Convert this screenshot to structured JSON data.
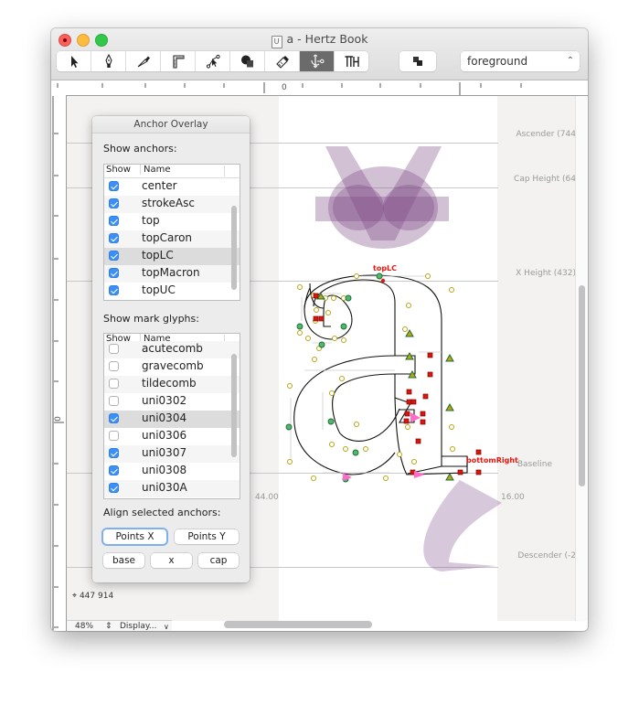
{
  "window": {
    "title": "a - Hertz Book",
    "doc_icon_letter": "U"
  },
  "toolbar": {
    "tools": [
      {
        "name": "select-tool",
        "icon": "arrow-pointer-icon",
        "active": false
      },
      {
        "name": "pen-tool",
        "icon": "pen-nib-icon",
        "active": false
      },
      {
        "name": "knife-tool",
        "icon": "knife-icon",
        "active": false
      },
      {
        "name": "measure-tool",
        "icon": "ruler-icon",
        "active": false
      },
      {
        "name": "node-tool",
        "icon": "node-select-icon",
        "active": false
      },
      {
        "name": "shape-tool",
        "icon": "shapes-icon",
        "active": false
      },
      {
        "name": "eraser-tool",
        "icon": "eraser-icon",
        "active": false
      },
      {
        "name": "anchor-tool",
        "icon": "anchor-icon",
        "active": true
      },
      {
        "name": "hinting-tool",
        "icon": "tth-icon",
        "active": false,
        "label": "TTH"
      }
    ],
    "layer_toggle_icon": "layer-squares-icon",
    "layer_select": "foreground"
  },
  "rulers": {
    "h_zero_label": "0",
    "v_zero_label": "0"
  },
  "metrics": [
    {
      "label": "Ascender (744",
      "key": "ascender"
    },
    {
      "label": "Cap Height (64",
      "key": "cap-height"
    },
    {
      "label": "X Height (432)",
      "key": "x-height"
    },
    {
      "label": "Baseline",
      "key": "baseline"
    },
    {
      "label": "Descender (-2",
      "key": "descender"
    }
  ],
  "sidebearings": {
    "left": "44.00",
    "right": "16.00"
  },
  "anchors_on_glyph": [
    {
      "label": "topLC"
    },
    {
      "label": "bottomRight"
    }
  ],
  "coords": "447 914",
  "status": {
    "zoom": "48%",
    "display": "Display..."
  },
  "panel": {
    "title": "Anchor Overlay",
    "show_anchors_label": "Show anchors:",
    "col_show": "Show",
    "col_name": "Name",
    "anchors": [
      {
        "name": "center",
        "checked": true
      },
      {
        "name": "strokeAsc",
        "checked": true
      },
      {
        "name": "top",
        "checked": true
      },
      {
        "name": "topCaron",
        "checked": true
      },
      {
        "name": "topLC",
        "checked": true,
        "selected": true
      },
      {
        "name": "topMacron",
        "checked": true
      },
      {
        "name": "topUC",
        "checked": true
      }
    ],
    "show_marks_label": "Show mark glyphs:",
    "marks": [
      {
        "name": "acutecomb",
        "checked": false
      },
      {
        "name": "gravecomb",
        "checked": false
      },
      {
        "name": "tildecomb",
        "checked": false
      },
      {
        "name": "uni0302",
        "checked": false
      },
      {
        "name": "uni0304",
        "checked": true,
        "selected": true
      },
      {
        "name": "uni0306",
        "checked": false
      },
      {
        "name": "uni0307",
        "checked": true
      },
      {
        "name": "uni0308",
        "checked": true
      },
      {
        "name": "uni030A",
        "checked": true
      }
    ],
    "align_label": "Align selected anchors:",
    "buttons": {
      "points_x": "Points X",
      "points_y": "Points Y",
      "base": "base",
      "x": "x",
      "cap": "cap"
    }
  },
  "colors": {
    "anchor_label": "#e8170f",
    "mark_overlay": "#8a5a93",
    "tool_active": "#6b6b6b",
    "checkbox": "#3c8ff7"
  }
}
